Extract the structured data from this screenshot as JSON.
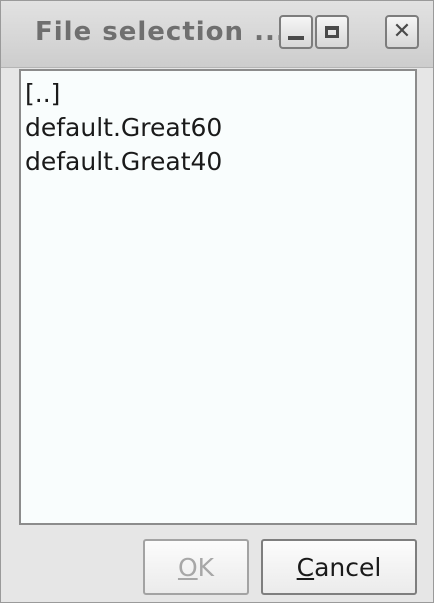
{
  "window": {
    "title": "File selection ...",
    "controls": {
      "minimize": "minimize-icon",
      "maximize": "maximize-icon",
      "close": "close-icon"
    }
  },
  "filelist": {
    "items": [
      {
        "label": "[..]"
      },
      {
        "label": "default.Great60"
      },
      {
        "label": "default.Great40"
      }
    ]
  },
  "buttons": {
    "ok": {
      "mnemonic": "O",
      "rest": "K",
      "enabled": false
    },
    "cancel": {
      "mnemonic": "C",
      "rest": "ancel",
      "enabled": true
    }
  }
}
